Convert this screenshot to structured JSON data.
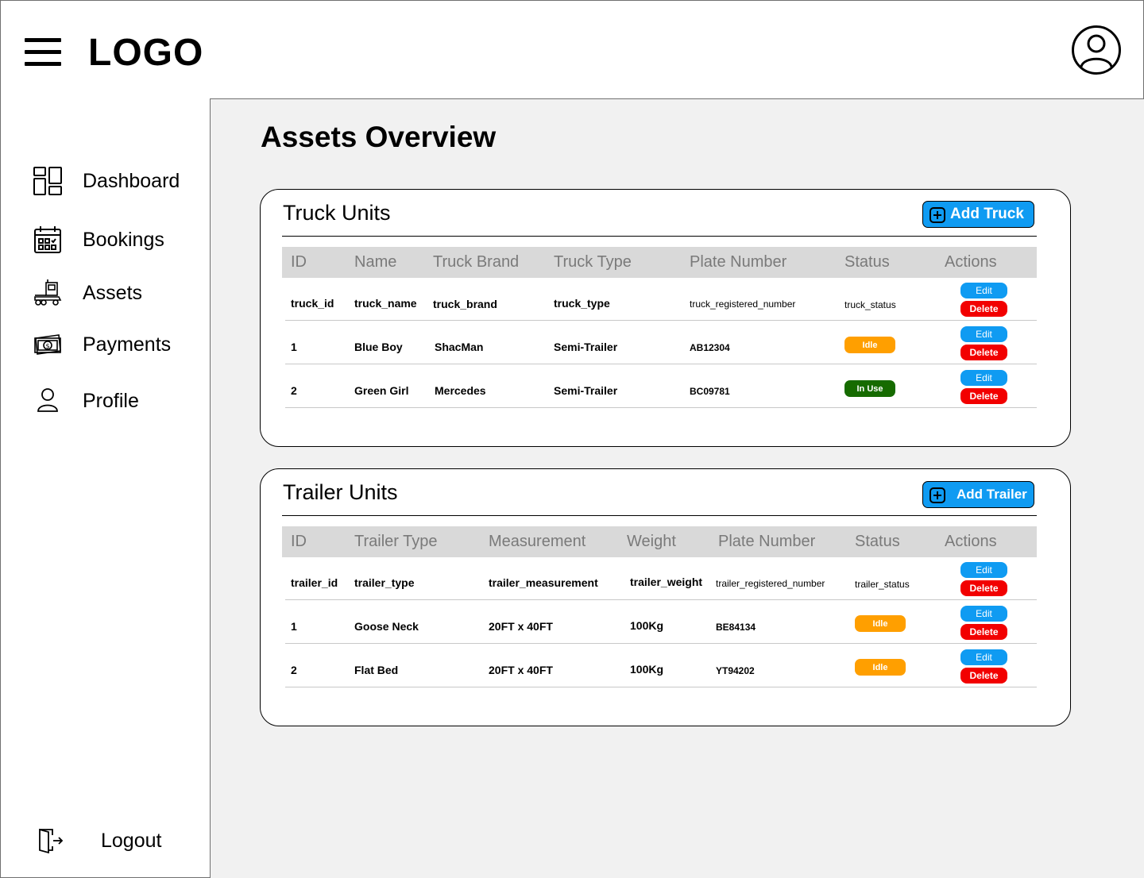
{
  "header": {
    "logo": "LOGO"
  },
  "sidebar": {
    "items": [
      {
        "label": "Dashboard",
        "icon": "dashboard-icon"
      },
      {
        "label": "Bookings",
        "icon": "calendar-icon"
      },
      {
        "label": "Assets",
        "icon": "truck-icon"
      },
      {
        "label": "Payments",
        "icon": "cash-icon"
      },
      {
        "label": "Profile",
        "icon": "user-icon"
      }
    ],
    "logout": {
      "label": "Logout",
      "icon": "logout-icon"
    }
  },
  "page": {
    "title": "Assets Overview"
  },
  "colors": {
    "accent": "#0f9bf2",
    "danger": "#f20000",
    "idle": "#ff9f00",
    "in_use": "#166b00"
  },
  "trucks": {
    "title": "Truck Units",
    "add_label": "Add Truck",
    "columns": [
      "ID",
      "Name",
      "Truck Brand",
      "Truck Type",
      "Plate Number",
      "Status",
      "Actions"
    ],
    "rows": [
      {
        "id": "truck_id",
        "name": "truck_name",
        "brand": "truck_brand",
        "type": "truck_type",
        "plate": "truck_registered_number",
        "status": "truck_status"
      },
      {
        "id": "1",
        "name": "Blue Boy",
        "brand": "ShacMan",
        "type": "Semi-Trailer",
        "plate": "AB12304",
        "status": "Idle"
      },
      {
        "id": "2",
        "name": "Green Girl",
        "brand": "Mercedes",
        "type": "Semi-Trailer",
        "plate": "BC09781",
        "status": "In Use"
      }
    ],
    "edit_label": "Edit",
    "delete_label": "Delete"
  },
  "trailers": {
    "title": "Trailer Units",
    "add_label": "Add Trailer",
    "columns": [
      "ID",
      "Trailer Type",
      "Measurement",
      "Weight",
      "Plate Number",
      "Status",
      "Actions"
    ],
    "rows": [
      {
        "id": "trailer_id",
        "type": "trailer_type",
        "measurement": "trailer_measurement",
        "weight": "trailer_weight",
        "plate": "trailer_registered_number",
        "status": "trailer_status"
      },
      {
        "id": "1",
        "type": "Goose Neck",
        "measurement": "20FT x 40FT",
        "weight": "100Kg",
        "plate": "BE84134",
        "status": "Idle"
      },
      {
        "id": "2",
        "type": "Flat Bed",
        "measurement": "20FT x 40FT",
        "weight": "100Kg",
        "plate": "YT94202",
        "status": "Idle"
      }
    ],
    "edit_label": "Edit",
    "delete_label": "Delete"
  }
}
